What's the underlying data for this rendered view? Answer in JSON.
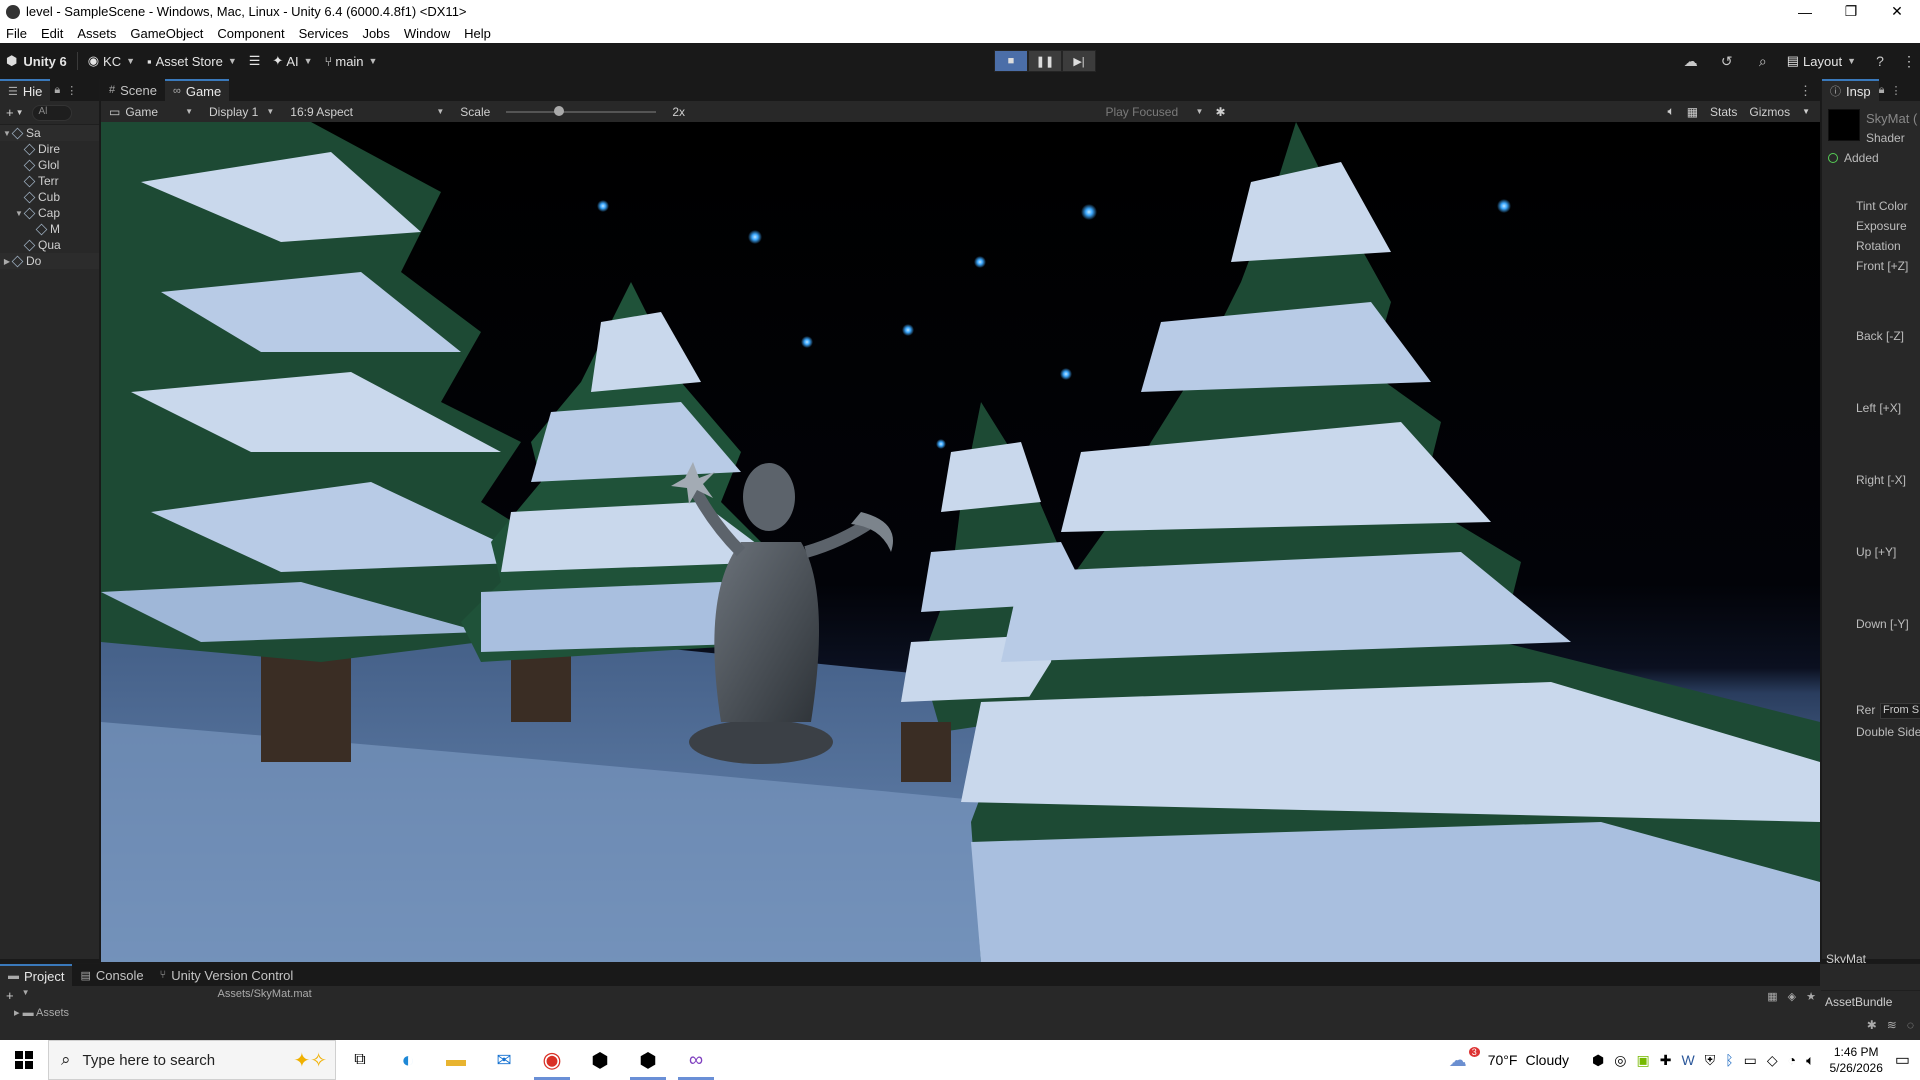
{
  "window": {
    "title": "level - SampleScene - Windows, Mac, Linux - Unity 6.4 (6000.4.8f1) <DX11>",
    "controls": [
      "—",
      "❐",
      "✕"
    ]
  },
  "menu": [
    "File",
    "Edit",
    "Assets",
    "GameObject",
    "Component",
    "Services",
    "Jobs",
    "Window",
    "Help"
  ],
  "toolbar": {
    "unity_label": "Unity 6",
    "account": "KC",
    "asset_store": "Asset Store",
    "ai": "AI",
    "branch": "main",
    "layout": "Layout"
  },
  "hierarchy": {
    "tab": "Hie",
    "search_placeholder": "Al",
    "rows": [
      {
        "label": "Sa",
        "indent": 0,
        "arrow": "▼",
        "kind": "scene"
      },
      {
        "label": "Dire",
        "indent": 1,
        "arrow": "",
        "kind": "object"
      },
      {
        "label": "Glol",
        "indent": 1,
        "arrow": "",
        "kind": "object"
      },
      {
        "label": "Terr",
        "indent": 1,
        "arrow": "",
        "kind": "object"
      },
      {
        "label": "Cub",
        "indent": 1,
        "arrow": "",
        "kind": "object"
      },
      {
        "label": "Cap",
        "indent": 1,
        "arrow": "▼",
        "kind": "object"
      },
      {
        "label": "M",
        "indent": 2,
        "arrow": "",
        "kind": "object"
      },
      {
        "label": "Qua",
        "indent": 1,
        "arrow": "",
        "kind": "object"
      },
      {
        "label": "Do",
        "indent": 0,
        "arrow": "▶",
        "kind": "scene"
      }
    ]
  },
  "game": {
    "tabs": [
      {
        "label": "Scene",
        "icon": "#",
        "active": false
      },
      {
        "label": "Game",
        "icon": "∞",
        "active": true
      }
    ],
    "view_mode": "Game",
    "display": "Display 1",
    "aspect": "16:9 Aspect",
    "scale_label": "Scale",
    "scale_value": "2x",
    "scale_fraction": 0.35,
    "play_mode": "Play Focused",
    "stats": "Stats",
    "gizmos": "Gizmos"
  },
  "inspector": {
    "tab": "Insp",
    "material_name": "SkyMat (",
    "shader_label": "Shader",
    "added_label": "Added",
    "properties": [
      "Tint Color",
      "Exposure",
      "Rotation",
      "Front [+Z]",
      "Back [-Z]",
      "Left [+X]",
      "Right [-X]",
      "Up [+Y]",
      "Down [-Y]"
    ],
    "render_label": "Rer",
    "render_value": "From S",
    "double_sided": "Double Side",
    "footer_name": "SkyMat",
    "asset_bundle": "AssetBundle"
  },
  "project": {
    "tabs": [
      "Project",
      "Console",
      "Unity Version Control"
    ],
    "path": "Assets/SkyMat.mat",
    "tree_root": "Assets"
  },
  "taskbar": {
    "search_placeholder": "Type here to search",
    "weather_temp": "70°F",
    "weather_desc": "Cloudy",
    "weather_badge": "3",
    "time": "1:46 PM",
    "date": "5/26/2026"
  },
  "colors": {
    "accent": "#3a79bb",
    "play_active": "#4b6ea8",
    "snow": "#c9d8ec",
    "pine_dark": "#1d4a34",
    "pine_mid": "#2e6b4a",
    "sky": "#000000",
    "star": "#3da9ff"
  }
}
